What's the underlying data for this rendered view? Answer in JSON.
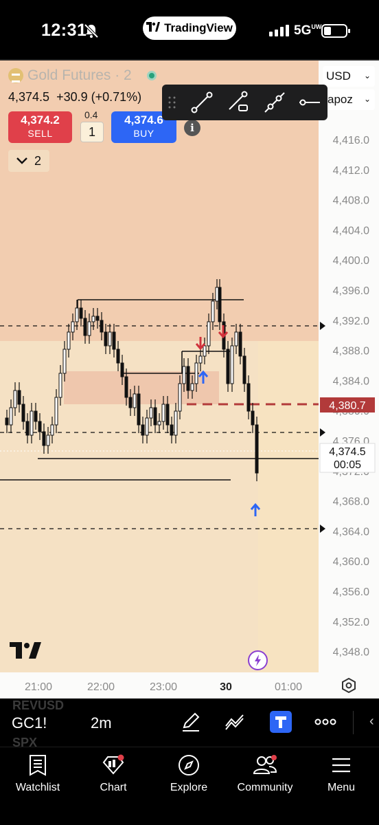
{
  "status_bar": {
    "time": "12:31",
    "app_pill": "TradingView",
    "network": "5G",
    "network_sub": "UW",
    "icons": [
      "bell-slash-icon",
      "signal-icon",
      "battery-icon"
    ]
  },
  "chart": {
    "symbol_title": "Gold Futures · 2",
    "last_price": "4,374.5",
    "change": "+30.9 (+0.71%)",
    "sell": {
      "price": "4,374.2",
      "label": "SELL"
    },
    "buy": {
      "price": "4,374.6",
      "label": "BUY"
    },
    "spread": "0.4",
    "quantity": "1",
    "collapse_count": "2",
    "currency": "USD",
    "scale_select": "apoz",
    "price_axis": [
      "4,416.0",
      "4,412.0",
      "4,408.0",
      "4,404.0",
      "4,400.0",
      "4,396.0",
      "4,392.0",
      "4,388.0",
      "4,384.0",
      "4,380.0",
      "4,376.0",
      "4,372.0",
      "4,368.0",
      "4,364.0",
      "4,360.0",
      "4,356.0",
      "4,352.0",
      "4,348.0"
    ],
    "time_axis": [
      "21:00",
      "22:00",
      "23:00",
      "30",
      "01:00"
    ],
    "order_line_label": "4,380.7",
    "current_price_label": "4,374.5",
    "countdown": "00:05",
    "colors": {
      "sell": "#e0404a",
      "buy": "#2d66f5",
      "zone": "#f5e1c4",
      "zone_dark": "#f0c9ac",
      "order_line": "#b23a3a"
    },
    "drawing_tools": [
      "trend-line-icon",
      "ray-icon",
      "extended-line-icon",
      "horizontal-line-icon"
    ]
  },
  "symbol_bar": {
    "ghost_above": "REVUSD",
    "symbol": "GC1!",
    "interval": "2m",
    "ghost_below": "SPX"
  },
  "tabs": [
    {
      "label": "Watchlist",
      "icon": "watchlist-icon"
    },
    {
      "label": "Chart",
      "icon": "chart-icon"
    },
    {
      "label": "Explore",
      "icon": "compass-icon"
    },
    {
      "label": "Community",
      "icon": "community-icon"
    },
    {
      "label": "Menu",
      "icon": "menu-icon"
    }
  ]
}
